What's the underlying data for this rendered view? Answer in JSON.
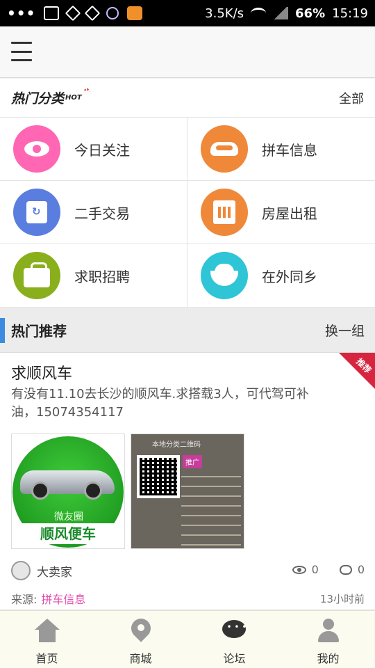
{
  "status_bar": {
    "dots": "•••",
    "net_speed": "3.5K/s",
    "battery": "66%",
    "time": "15:19"
  },
  "header": {
    "menu_icon": "hamburger-menu-icon"
  },
  "categories_section": {
    "title": "热门分类",
    "hot_badge": "HOT",
    "all_label": "全部",
    "items": [
      {
        "label": "今日关注",
        "icon": "eye-icon",
        "color": "#ff66b3"
      },
      {
        "label": "拼车信息",
        "icon": "car-icon",
        "color": "#f0883a"
      },
      {
        "label": "二手交易",
        "icon": "shopping-bag-icon",
        "color": "#5a7de0"
      },
      {
        "label": "房屋出租",
        "icon": "house-icon",
        "color": "#f0883a"
      },
      {
        "label": "求职招聘",
        "icon": "briefcase-icon",
        "color": "#8aaf1c"
      },
      {
        "label": "在外同乡",
        "icon": "bowl-icon",
        "color": "#2ec5d6"
      }
    ]
  },
  "recommend_section": {
    "title": "热门推荐",
    "refresh_label": "换一组",
    "accent": "#3d8be0"
  },
  "post": {
    "title": "求顺风车",
    "badge": "推荐",
    "body": "有没有11.10去长沙的顺风车.求搭载3人，可代驾可补油，15074354117",
    "image1": {
      "sub": "微友圈",
      "caption": "顺风便车"
    },
    "image2": {
      "title": "本地分类二维码",
      "tag": "推广"
    },
    "author": "大卖家",
    "views": "0",
    "comments": "0",
    "source_label": "来源:",
    "source_category": "拼车信息",
    "time_ago": "13小时前"
  },
  "bottom_nav": {
    "items": [
      {
        "label": "首页",
        "icon": "home-icon"
      },
      {
        "label": "商城",
        "icon": "map-pin-icon"
      },
      {
        "label": "论坛",
        "icon": "chat-bubbles-icon"
      },
      {
        "label": "我的",
        "icon": "user-icon"
      }
    ]
  }
}
